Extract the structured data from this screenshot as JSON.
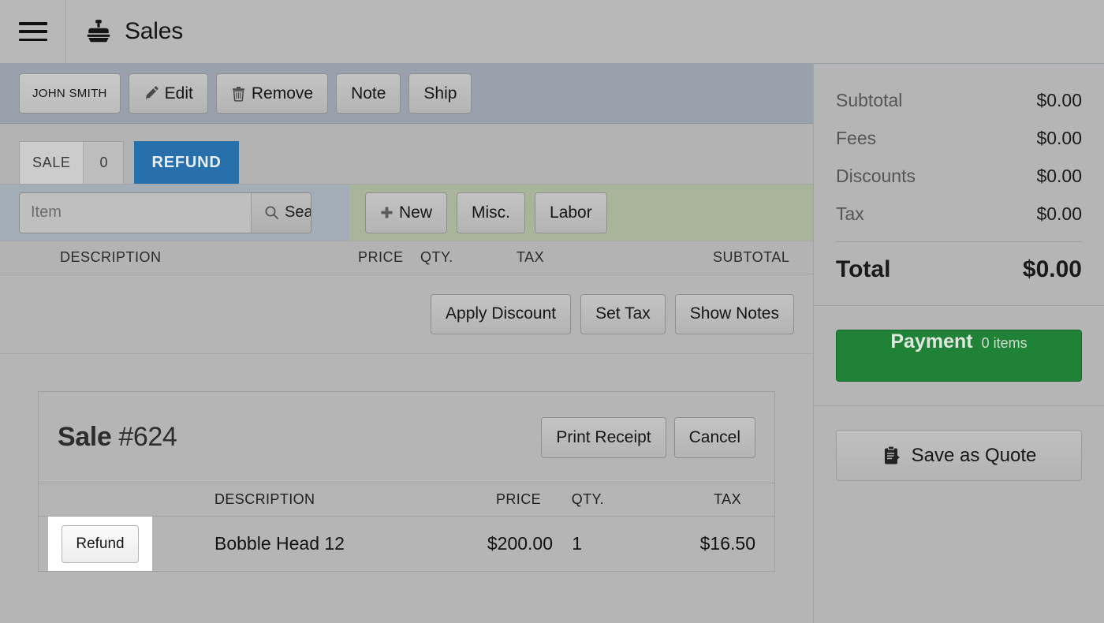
{
  "header": {
    "menu_icon": "hamburger-icon",
    "app_icon": "cash-register-icon",
    "title": "Sales"
  },
  "customer_bar": {
    "customer_name": "JOHN SMITH",
    "buttons": [
      {
        "label": "Edit",
        "icon": "pencil-icon"
      },
      {
        "label": "Remove",
        "icon": "trash-icon"
      },
      {
        "label": "Note",
        "icon": ""
      },
      {
        "label": "Ship",
        "icon": ""
      }
    ]
  },
  "tabs": {
    "sale_label": "SALE",
    "sale_count": "0",
    "refund_label": "REFUND"
  },
  "search": {
    "placeholder": "Item",
    "value": "",
    "search_label": "Search",
    "search_icon": "magnifier-icon"
  },
  "quick_actions": [
    {
      "label": "New",
      "icon": "plus-icon"
    },
    {
      "label": "Misc.",
      "icon": ""
    },
    {
      "label": "Labor",
      "icon": ""
    }
  ],
  "line_items_header": {
    "description": "DESCRIPTION",
    "price": "PRICE",
    "qty": "QTY.",
    "tax": "TAX",
    "subtotal": "SUBTOTAL"
  },
  "item_actions": [
    {
      "label": "Apply Discount"
    },
    {
      "label": "Set Tax"
    },
    {
      "label": "Show Notes"
    }
  ],
  "sale_panel": {
    "title_word": "Sale",
    "title_number": "#624",
    "buttons": [
      {
        "label": "Print Receipt"
      },
      {
        "label": "Cancel"
      }
    ],
    "columns": {
      "description": "DESCRIPTION",
      "price": "PRICE",
      "qty": "QTY.",
      "tax": "TAX"
    },
    "rows": [
      {
        "action_label": "Refund",
        "description": "Bobble Head 12",
        "price": "$200.00",
        "qty": "1",
        "tax": "$16.50",
        "focused": true
      }
    ]
  },
  "sidebar": {
    "totals": [
      {
        "label": "Subtotal",
        "value": "$0.00"
      },
      {
        "label": "Fees",
        "value": "$0.00"
      },
      {
        "label": "Discounts",
        "value": "$0.00"
      },
      {
        "label": "Tax",
        "value": "$0.00"
      }
    ],
    "grand_total": {
      "label": "Total",
      "value": "$0.00"
    },
    "payment": {
      "label": "Payment",
      "items": "0 items"
    },
    "quote": {
      "label": "Save as Quote",
      "icon": "clipboard-arrow-icon"
    }
  },
  "colors": {
    "accent_blue": "#2870ab",
    "payment_green": "#1f8236",
    "customer_bar_bg": "#99a1ac",
    "search_zone_bg": "#a3adb8",
    "actions_zone_bg": "#a8b59a",
    "page_bg": "#b5b5b5"
  }
}
